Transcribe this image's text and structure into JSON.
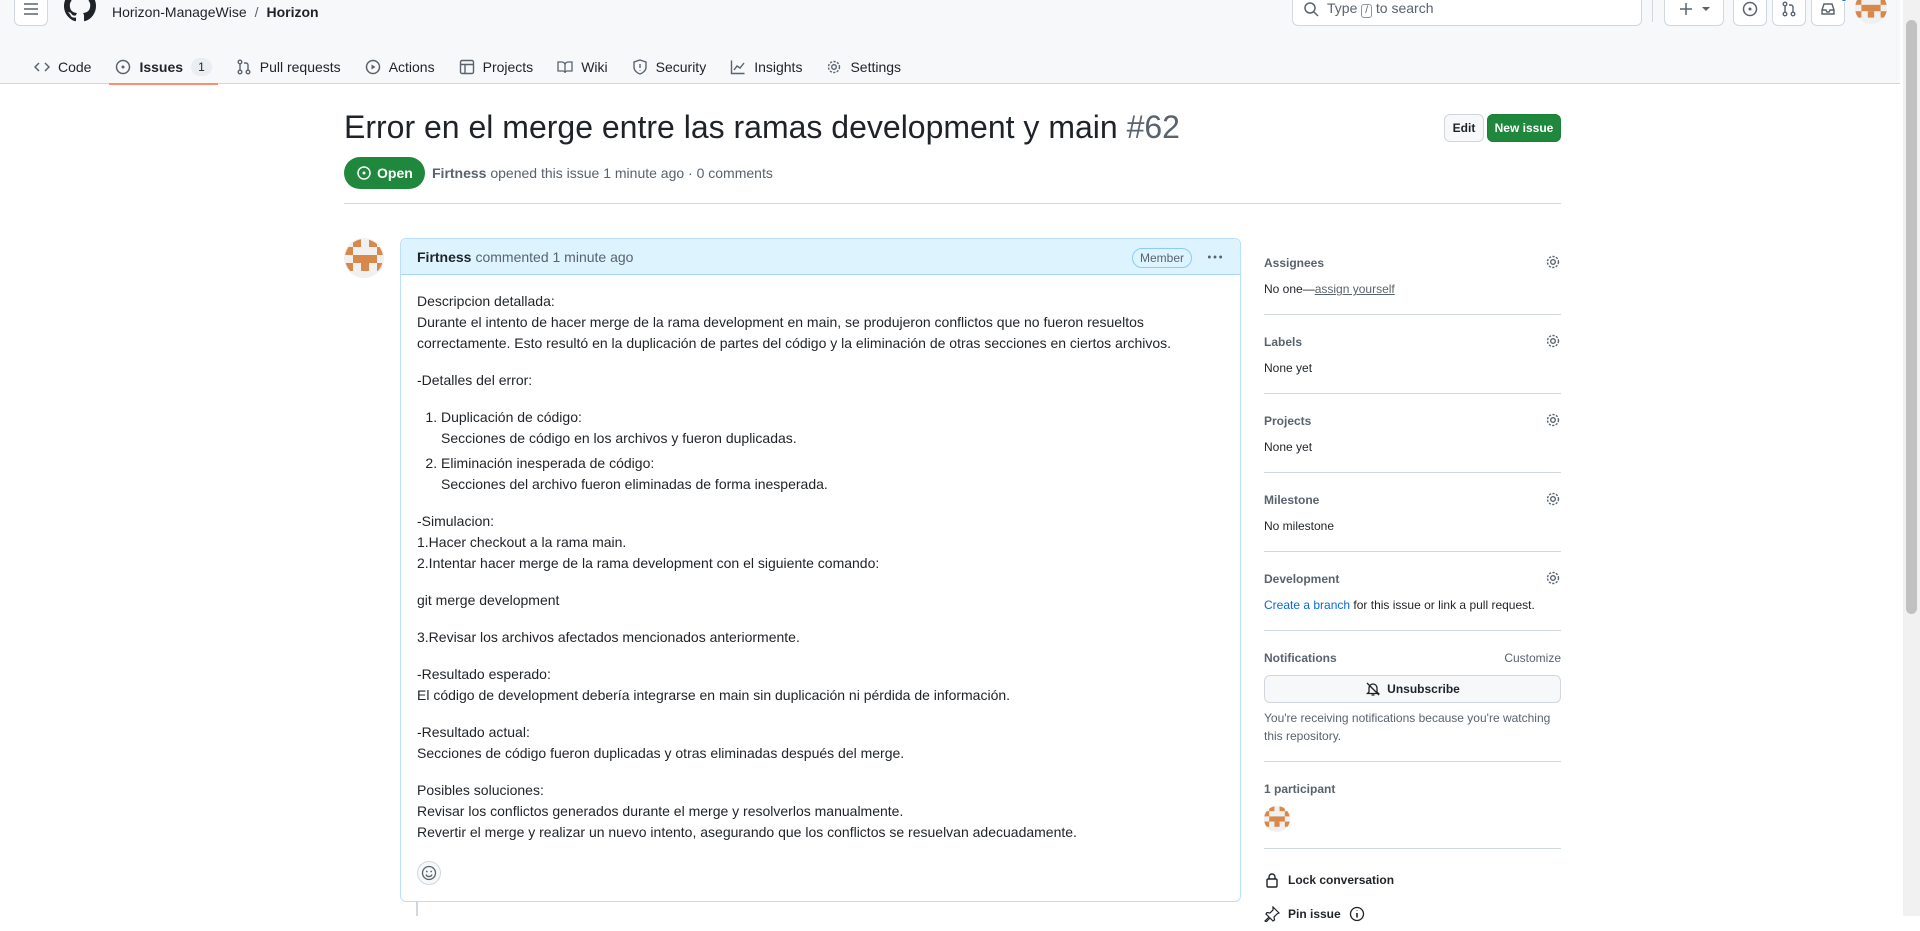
{
  "header": {
    "owner": "Horizon-ManageWise",
    "separator": "/",
    "repo": "Horizon",
    "search_prefix": "Type",
    "search_key": "/",
    "search_suffix": "to search"
  },
  "tabs": [
    {
      "label": "Code"
    },
    {
      "label": "Issues",
      "count": "1"
    },
    {
      "label": "Pull requests"
    },
    {
      "label": "Actions"
    },
    {
      "label": "Projects"
    },
    {
      "label": "Wiki"
    },
    {
      "label": "Security"
    },
    {
      "label": "Insights"
    },
    {
      "label": "Settings"
    }
  ],
  "issue": {
    "title": "Error en el merge entre las ramas development y main",
    "number": "#62",
    "edit_label": "Edit",
    "new_issue_label": "New issue",
    "state": "Open",
    "author": "Firtness",
    "meta_text": "opened this issue 1 minute ago · 0 comments"
  },
  "comment": {
    "author": "Firtness",
    "time": "commented 1 minute ago",
    "badge": "Member",
    "p1_line1": "Descripcion detallada:",
    "p1_line2": "Durante el intento de hacer merge de la rama development en main, se produjeron conflictos que no fueron resueltos correctamente. Esto resultó en la duplicación de partes del código y la eliminación de otras secciones en ciertos archivos.",
    "p2": "-Detalles del error:",
    "li1_title": "Duplicación de código:",
    "li1_desc": "Secciones de código en los archivos y fueron duplicadas.",
    "li2_title": "Eliminación inesperada de código:",
    "li2_desc": "Secciones del archivo fueron eliminadas de forma inesperada.",
    "sim_1": "-Simulacion:",
    "sim_2": "1.Hacer checkout a la rama main.",
    "sim_3": "2.Intentar hacer merge de la rama development con el siguiente comando:",
    "cmd": "git merge development",
    "step3": "3.Revisar los archivos afectados mencionados anteriormente.",
    "exp_1": "-Resultado esperado:",
    "exp_2": "El código de development debería integrarse en main sin duplicación ni pérdida de información.",
    "act_1": "-Resultado actual:",
    "act_2": "Secciones de código fueron duplicadas y otras eliminadas después del merge.",
    "sol_1": "Posibles soluciones:",
    "sol_2": "Revisar los conflictos generados durante el merge y resolverlos manualmente.",
    "sol_3": "Revertir el merge y realizar un nuevo intento, asegurando que los conflictos se resuelvan adecuadamente."
  },
  "sidebar": {
    "assignees_h": "Assignees",
    "assignees_none": "No one—",
    "assign_link": "assign yourself",
    "labels_h": "Labels",
    "labels_v": "None yet",
    "projects_h": "Projects",
    "projects_v": "None yet",
    "milestone_h": "Milestone",
    "milestone_v": "No milestone",
    "dev_h": "Development",
    "dev_link": "Create a branch",
    "dev_rest": " for this issue or link a pull request.",
    "notif_h": "Notifications",
    "customize": "Customize",
    "unsubscribe": "Unsubscribe",
    "notif_note": "You're receiving notifications because you're watching this repository.",
    "participants_h": "1 participant",
    "lock": "Lock conversation",
    "pin": "Pin issue"
  },
  "colors": {
    "open_green": "#1f883d",
    "accent_blue": "#0969da",
    "tab_underline": "#fd8c73"
  }
}
